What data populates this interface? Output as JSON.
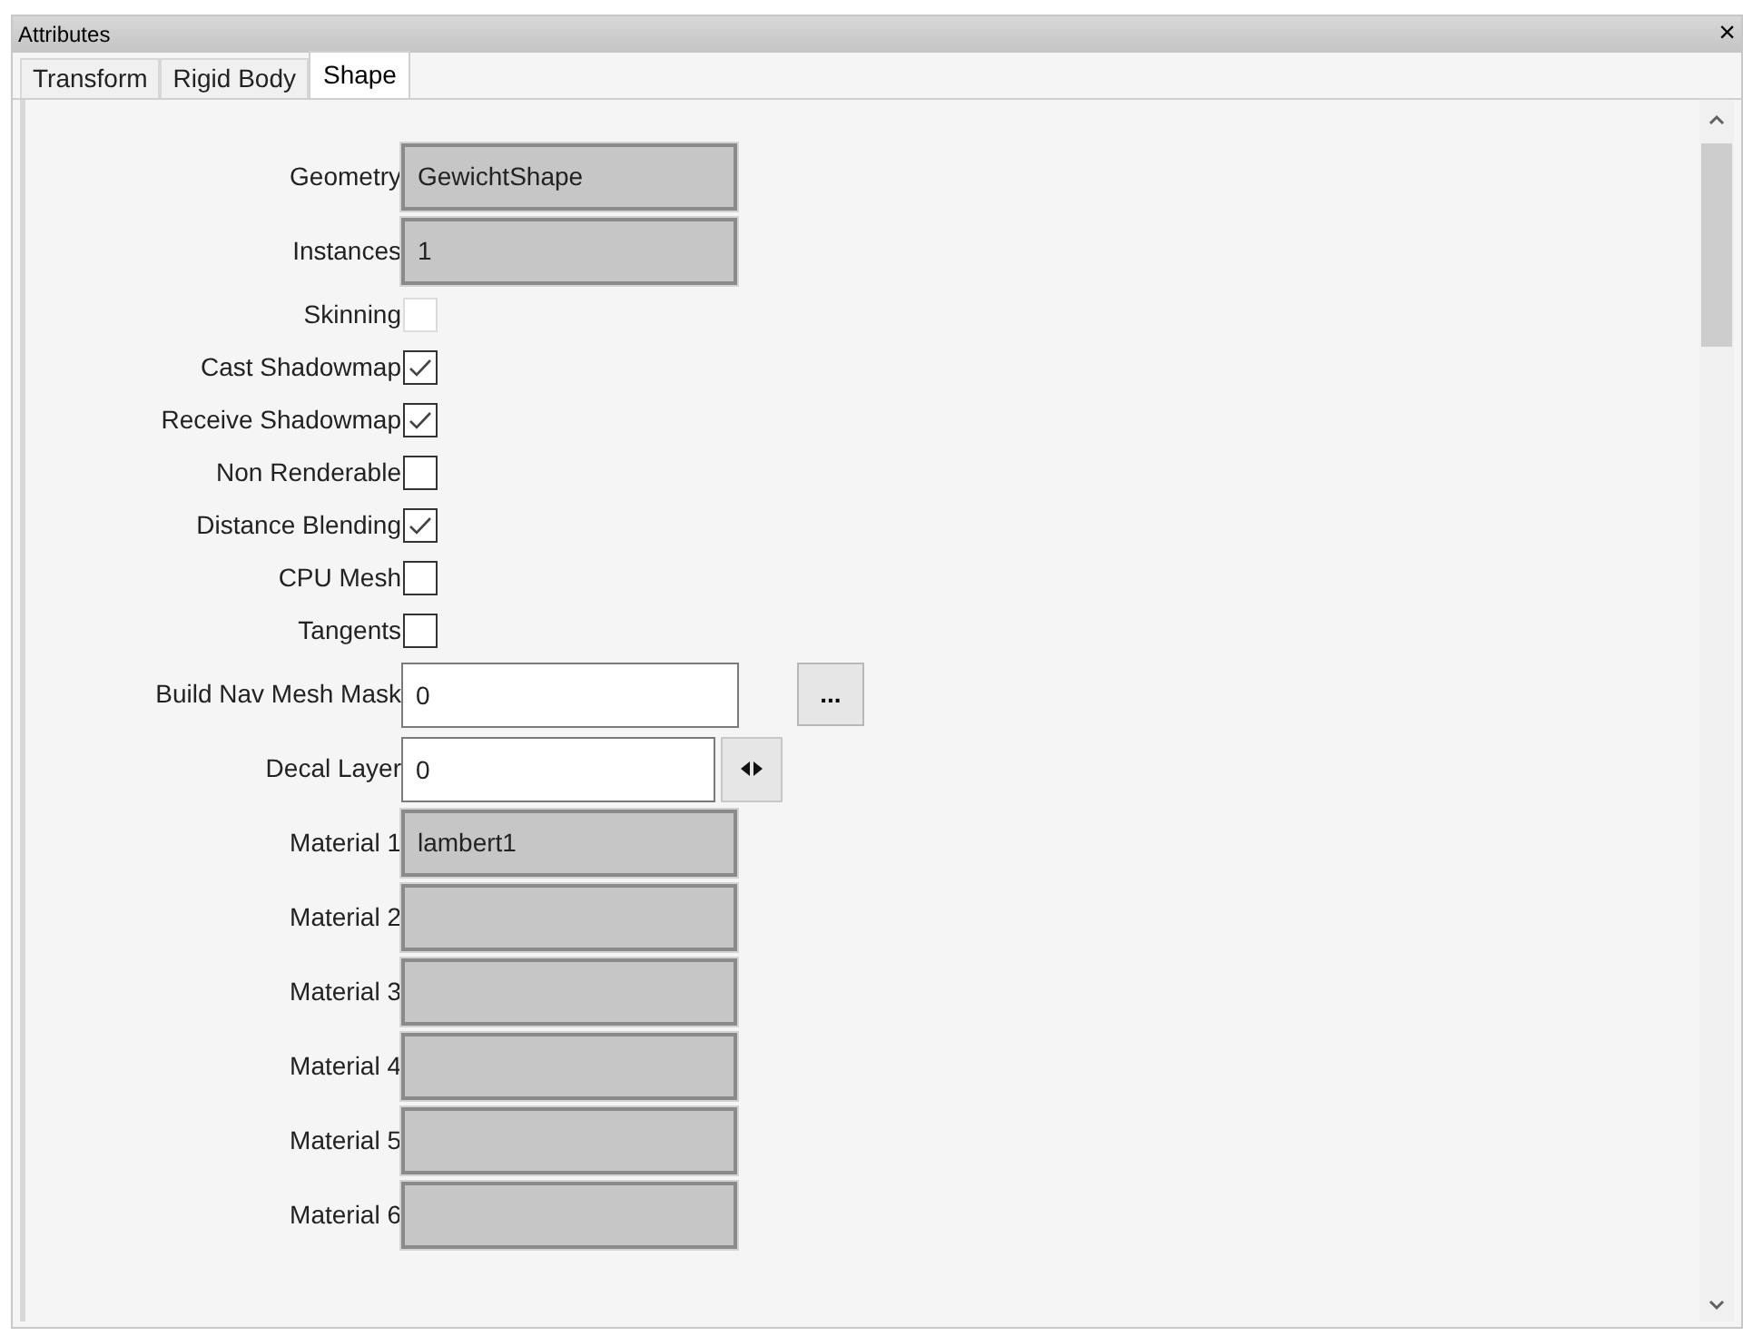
{
  "panel": {
    "title": "Attributes",
    "close": "×"
  },
  "tabs": [
    {
      "label": "Transform",
      "selected": false
    },
    {
      "label": "Rigid Body",
      "selected": false
    },
    {
      "label": "Shape",
      "selected": true
    }
  ],
  "rows": [
    {
      "kind": "readonly",
      "label": "Geometry",
      "value": "GewichtShape"
    },
    {
      "kind": "readonly",
      "label": "Instances",
      "value": "1"
    },
    {
      "kind": "checkbox",
      "label": "Skinning",
      "checked": false,
      "disabled": true
    },
    {
      "kind": "checkbox",
      "label": "Cast Shadowmap",
      "checked": true,
      "disabled": false
    },
    {
      "kind": "checkbox",
      "label": "Receive Shadowmap",
      "checked": true,
      "disabled": false
    },
    {
      "kind": "checkbox",
      "label": "Non Renderable",
      "checked": false,
      "disabled": false
    },
    {
      "kind": "checkbox",
      "label": "Distance Blending",
      "checked": true,
      "disabled": false
    },
    {
      "kind": "checkbox",
      "label": "CPU Mesh",
      "checked": false,
      "disabled": false
    },
    {
      "kind": "checkbox",
      "label": "Tangents",
      "checked": false,
      "disabled": false
    },
    {
      "kind": "text_button",
      "label": "Build Nav Mesh Mask",
      "value": "0",
      "button": "..."
    },
    {
      "kind": "spinner",
      "label": "Decal Layer",
      "value": "0"
    },
    {
      "kind": "readonly",
      "label": "Material 1",
      "value": "lambert1"
    },
    {
      "kind": "readonly",
      "label": "Material 2"
    },
    {
      "kind": "readonly",
      "label": "Material 3"
    },
    {
      "kind": "readonly",
      "label": "Material 4"
    },
    {
      "kind": "readonly",
      "label": "Material 5"
    },
    {
      "kind": "readonly",
      "label": "Material 6"
    }
  ]
}
